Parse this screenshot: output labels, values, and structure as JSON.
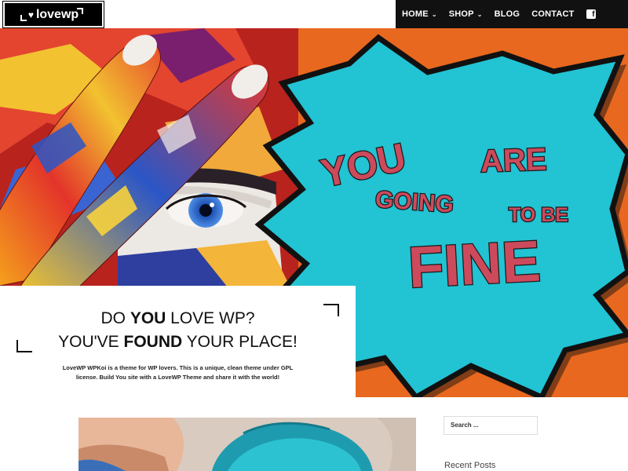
{
  "header": {
    "logo_text": "lovewp",
    "nav": [
      {
        "label": "HOME",
        "has_dropdown": true
      },
      {
        "label": "SHOP",
        "has_dropdown": true
      },
      {
        "label": "BLOG",
        "has_dropdown": false
      },
      {
        "label": "CONTACT",
        "has_dropdown": false
      }
    ],
    "social_icon": "facebook-icon"
  },
  "hero": {
    "bubble": {
      "line1_a": "YOU",
      "line1_b": "ARE",
      "line2_a": "GOING",
      "line2_b": "TO BE",
      "line3": "FINE"
    }
  },
  "intro": {
    "line1_pre": "DO ",
    "line1_bold": "YOU",
    "line1_post": " LOVE WP?",
    "line2_pre": "YOU'VE ",
    "line2_bold": "FOUND",
    "line2_post": " YOUR PLACE!",
    "tagline": "LoveWP WPKoi is a theme for WP lovers. This is a unique, clean theme under GPL license. Build You site with a LoveWP Theme and share it with the world!"
  },
  "sidebar": {
    "search_placeholder": "Search ...",
    "recent_posts_title": "Recent Posts"
  },
  "colors": {
    "orange": "#e8681f",
    "cyan": "#22c3d3",
    "pink_text": "#cc4a5c",
    "nav_bg": "#111111"
  }
}
